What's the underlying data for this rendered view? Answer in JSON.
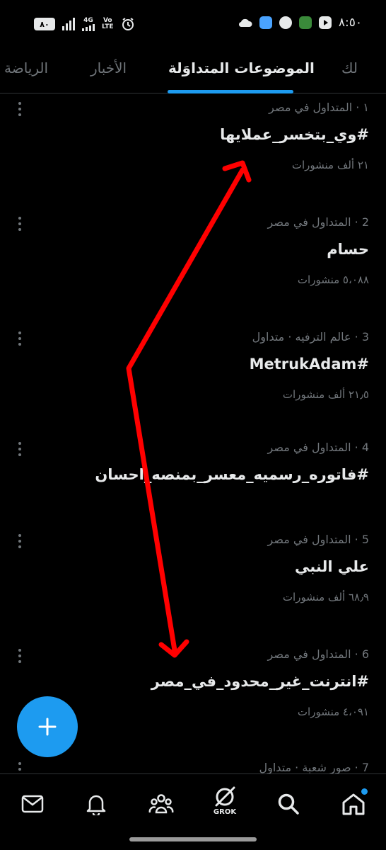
{
  "status_bar": {
    "battery": "٨٠",
    "network": "4G",
    "volte_top": "Vo",
    "volte_bottom": "LTE",
    "clock": "٨:٥٠"
  },
  "tabs": [
    {
      "label": "لك"
    },
    {
      "label": "الموضوعات المتداوَلة",
      "active": true
    },
    {
      "label": "الأخبار"
    },
    {
      "label": "الرياضة"
    }
  ],
  "trends": [
    {
      "meta": "١ · المتداول في مصر",
      "title": "#وي_بتخسر_عملايها",
      "count": "٢١ ألف منشورات"
    },
    {
      "meta": "2 · المتداول في مصر",
      "title": "حسام",
      "count": "٥،٠٨٨ منشورات"
    },
    {
      "meta": "3 · عالم الترفيه · متداول",
      "title": "#MetrukAdam",
      "count": "٢١٫٥ ألف منشورات"
    },
    {
      "meta": "4 · المتداول في مصر",
      "title": "#فاتوره_رسميه_معسر_بمنصه_احسان",
      "count": ""
    },
    {
      "meta": "5 · المتداول في مصر",
      "title": "علي النبي",
      "count": "٦٨٫٩ ألف منشورات"
    },
    {
      "meta": "6 · المتداول في مصر",
      "title": "#انترنت_غير_محدود_في_مصر",
      "count": "٤،٠٩١ منشورات"
    },
    {
      "meta": "7 · صور شعبة · متداول",
      "title": "",
      "count": ""
    }
  ],
  "bottom_nav": {
    "grok_label": "GROK"
  },
  "colors": {
    "accent": "#1d9bf0",
    "annotation": "#ff0000",
    "background": "#000000"
  }
}
